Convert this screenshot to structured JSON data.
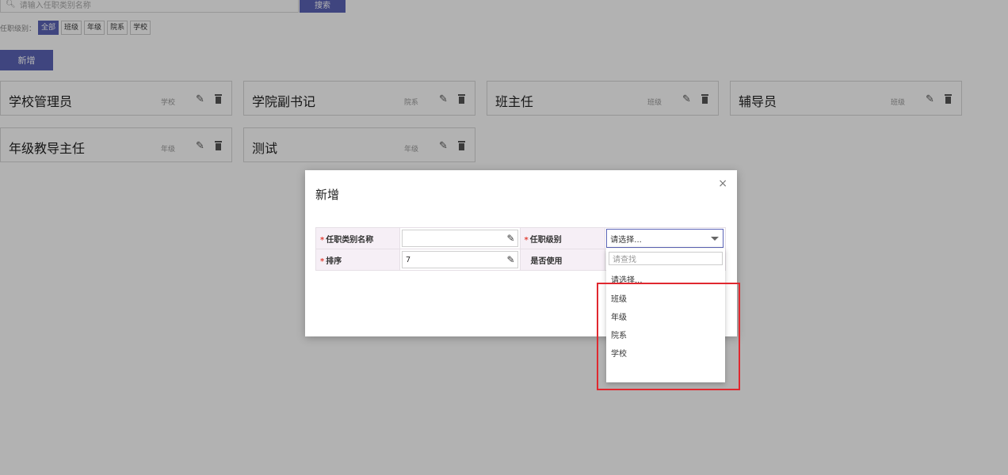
{
  "search": {
    "placeholder": "请输入任职类别名称",
    "button": "搜索"
  },
  "filter": {
    "label": "任职级别：",
    "chips": [
      "全部",
      "班级",
      "年级",
      "院系",
      "学校"
    ],
    "active_index": 0
  },
  "toolbar": {
    "add_label": "新增"
  },
  "cards": [
    {
      "name": "学校管理员",
      "level": "学校"
    },
    {
      "name": "学院副书记",
      "level": "院系"
    },
    {
      "name": "班主任",
      "level": "班级"
    },
    {
      "name": "辅导员",
      "level": "班级"
    },
    {
      "name": "年级教导主任",
      "level": "年级"
    },
    {
      "name": "测试",
      "level": "年级"
    }
  ],
  "modal": {
    "title": "新增",
    "close": "×",
    "fields": {
      "name_label": "任职类别名称",
      "name_value": "",
      "level_label": "任职级别",
      "level_value": "请选择...",
      "order_label": "排序",
      "order_value": "7",
      "active_label": "是否使用"
    }
  },
  "dropdown": {
    "search_placeholder": "请查找",
    "options": [
      "请选择...",
      "班级",
      "年级",
      "院系",
      "学校"
    ]
  },
  "colors": {
    "accent": "#5b63b7",
    "required": "#e0443a",
    "highlight": "#e0282f"
  }
}
